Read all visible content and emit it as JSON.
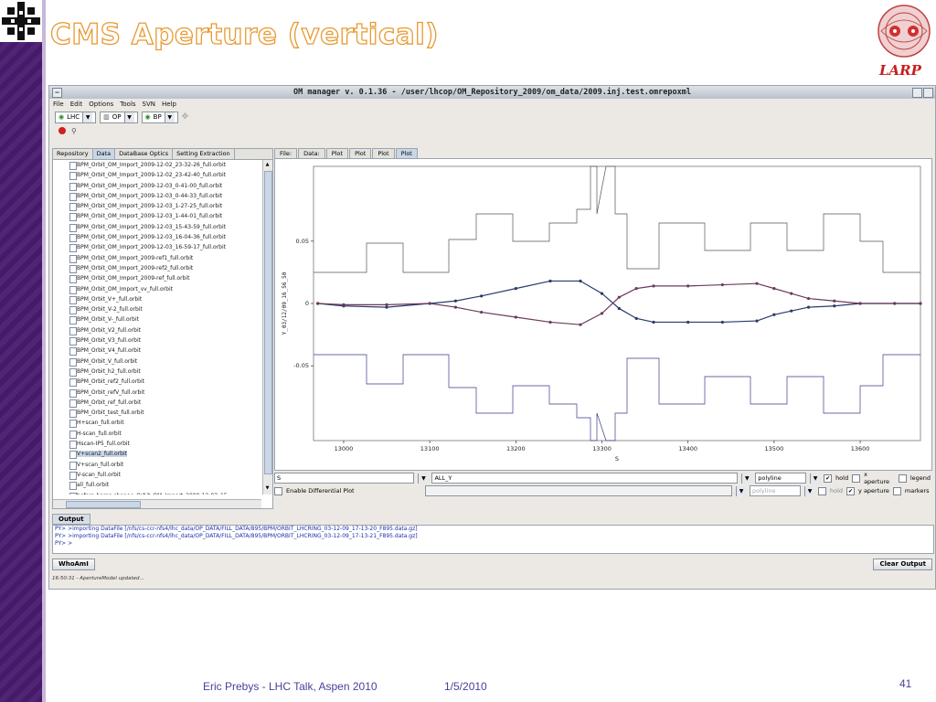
{
  "slide": {
    "title": "CMS Aperture (vertical)",
    "larp_label": "LARP",
    "footer_author": "Eric Prebys - LHC Talk, Aspen 2010",
    "footer_date": "1/5/2010",
    "page_number": "41"
  },
  "window": {
    "title": "OM manager v. 0.1.36 - /user/lhcop/OM_Repository_2009/om_data/2009.inj.test.omrepoxml"
  },
  "menu": [
    "File",
    "Edit",
    "Options",
    "Tools",
    "SVN",
    "Help"
  ],
  "toolbar": {
    "combos": [
      {
        "icon": "lhc-icon",
        "value": "LHC"
      },
      {
        "icon": "op-icon",
        "value": "OP"
      },
      {
        "icon": "bp-icon",
        "value": "BP"
      }
    ]
  },
  "left_tabs": [
    "Repository",
    "Data",
    "DataBase Optics",
    "Setting Extraction"
  ],
  "files": [
    "BPM_Orbit_OM_Import_2009-12-02_23-32-26_full.orbit",
    "BPM_Orbit_OM_Import_2009-12-02_23-42-40_full.orbit",
    "BPM_Orbit_OM_Import_2009-12-03_0-41-00_full.orbit",
    "BPM_Orbit_OM_Import_2009-12-03_0-44-33_full.orbit",
    "BPM_Orbit_OM_Import_2009-12-03_1-27-25_full.orbit",
    "BPM_Orbit_OM_Import_2009-12-03_1-44-01_full.orbit",
    "BPM_Orbit_OM_Import_2009-12-03_15-43-59_full.orbit",
    "BPM_Orbit_OM_Import_2009-12-03_16-04-36_full.orbit",
    "BPM_Orbit_OM_Import_2009-12-03_16-59-17_full.orbit",
    "BPM_Orbit_OM_Import_2009-ref1_full.orbit",
    "BPM_Orbit_OM_Import_2009-ref2_full.orbit",
    "BPM_Orbit_OM_Import_2009-ref_full.orbit",
    "BPM_Orbit_OM_Import_vv_full.orbit",
    "BPM_Orbit_V+_full.orbit",
    "BPM_Orbit_V-2_full.orbit",
    "BPM_Orbit_V-_full.orbit",
    "BPM_Orbit_V2_full.orbit",
    "BPM_Orbit_V3_full.orbit",
    "BPM_Orbit_V4_full.orbit",
    "BPM_Orbit_V_full.orbit",
    "BPM_Orbit_h2_full.orbit",
    "BPM_Orbit_ref2_full.orbit",
    "BPM_Orbit_refV_full.orbit",
    "BPM_Orbit_ref_full.orbit",
    "BPM_Orbit_test_full.orbit",
    "H+scan_full.orbit",
    "H-scan_full.orbit",
    "Hscan-IP5_full.orbit",
    "V+scan2_full.orbit",
    "V+scan_full.orbit",
    "V-scan_full.orbit",
    "all_full.orbit",
    "before-bpms-change_Orbit_OM_Import_2009-12-03_15"
  ],
  "selected_file_index": 28,
  "right_tabs": [
    "File:",
    "Data:",
    "Plot",
    "Plot",
    "Plot",
    "Plot"
  ],
  "chart_data": {
    "type": "line",
    "xlabel": "S",
    "ylabel": "Y_03/12/09_16_56_50",
    "xlim": [
      12965,
      13670
    ],
    "ylim": [
      -0.11,
      0.11
    ],
    "x_ticks": [
      "13000",
      "13100",
      "13200",
      "13300",
      "13400",
      "13500",
      "13600"
    ],
    "y_ticks": [
      "0.05",
      "0",
      "-0.05"
    ],
    "series": [
      {
        "color": "#2a3a6a",
        "x": [
          12970,
          13000,
          13050,
          13100,
          13130,
          13160,
          13200,
          13240,
          13275,
          13300,
          13320,
          13340,
          13360,
          13400,
          13440,
          13480,
          13500,
          13520,
          13540,
          13570,
          13600,
          13640,
          13670
        ],
        "y": [
          0.0,
          -0.002,
          -0.003,
          0.0,
          0.002,
          0.006,
          0.012,
          0.018,
          0.018,
          0.008,
          -0.004,
          -0.012,
          -0.015,
          -0.015,
          -0.015,
          -0.014,
          -0.009,
          -0.006,
          -0.003,
          -0.002,
          0.0,
          0.0,
          0.0
        ]
      },
      {
        "color": "#6a3a5a",
        "x": [
          12970,
          13000,
          13050,
          13100,
          13130,
          13160,
          13200,
          13240,
          13275,
          13300,
          13320,
          13340,
          13360,
          13400,
          13440,
          13480,
          13500,
          13520,
          13540,
          13570,
          13600,
          13640,
          13670
        ],
        "y": [
          0.0,
          -0.001,
          -0.001,
          0.0,
          -0.003,
          -0.007,
          -0.011,
          -0.015,
          -0.017,
          -0.008,
          0.005,
          0.012,
          0.014,
          0.014,
          0.015,
          0.016,
          0.012,
          0.008,
          0.004,
          0.002,
          0.0,
          0.0,
          0.0
        ]
      }
    ]
  },
  "controls": {
    "x_field": "S",
    "y_field": "ALL_Y",
    "style": "polyline",
    "style2": "polyline",
    "hold_label": "hold",
    "x_aperture_label": "x aperture",
    "legend_label": "legend",
    "diff_label": "Enable Differential Plot",
    "hold2_label": "hold",
    "y_aperture_label": "y aperture",
    "markers_label": "markers"
  },
  "output": {
    "header": "Output",
    "lines": [
      "PY> >importing DataFile [/nfs/cs-ccr-nfs4/lhc_data/OP_DATA/FILL_DATA/895/BPM/ORBIT_LHCRING_03-12-09_17-13-20_F895.data.gz]",
      "PY> >importing DataFile [/nfs/cs-ccr-nfs4/lhc_data/OP_DATA/FILL_DATA/895/BPM/ORBIT_LHCRING_03-12-09_17-13-21_F895.data.gz]",
      "PY> >"
    ],
    "whoami": "WhoAmI",
    "clear": "Clear Output",
    "status": "16:50:31 - ApertureModel updated..."
  }
}
